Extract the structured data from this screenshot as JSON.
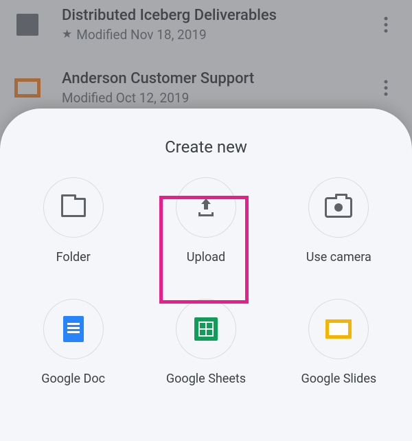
{
  "files": [
    {
      "title": "Distributed Iceberg Deliverables",
      "starred": true,
      "subtitle": "Modified Nov 18, 2019"
    },
    {
      "title": "Anderson Customer Support",
      "starred": false,
      "subtitle": "Modified Oct 12, 2019"
    }
  ],
  "sheet": {
    "title": "Create new",
    "options": [
      {
        "label": "Folder"
      },
      {
        "label": "Upload"
      },
      {
        "label": "Use camera"
      },
      {
        "label": "Google Doc"
      },
      {
        "label": "Google Sheets"
      },
      {
        "label": "Google Slides"
      }
    ]
  },
  "highlight": {
    "color": "#e81e8c",
    "target": "Upload"
  }
}
